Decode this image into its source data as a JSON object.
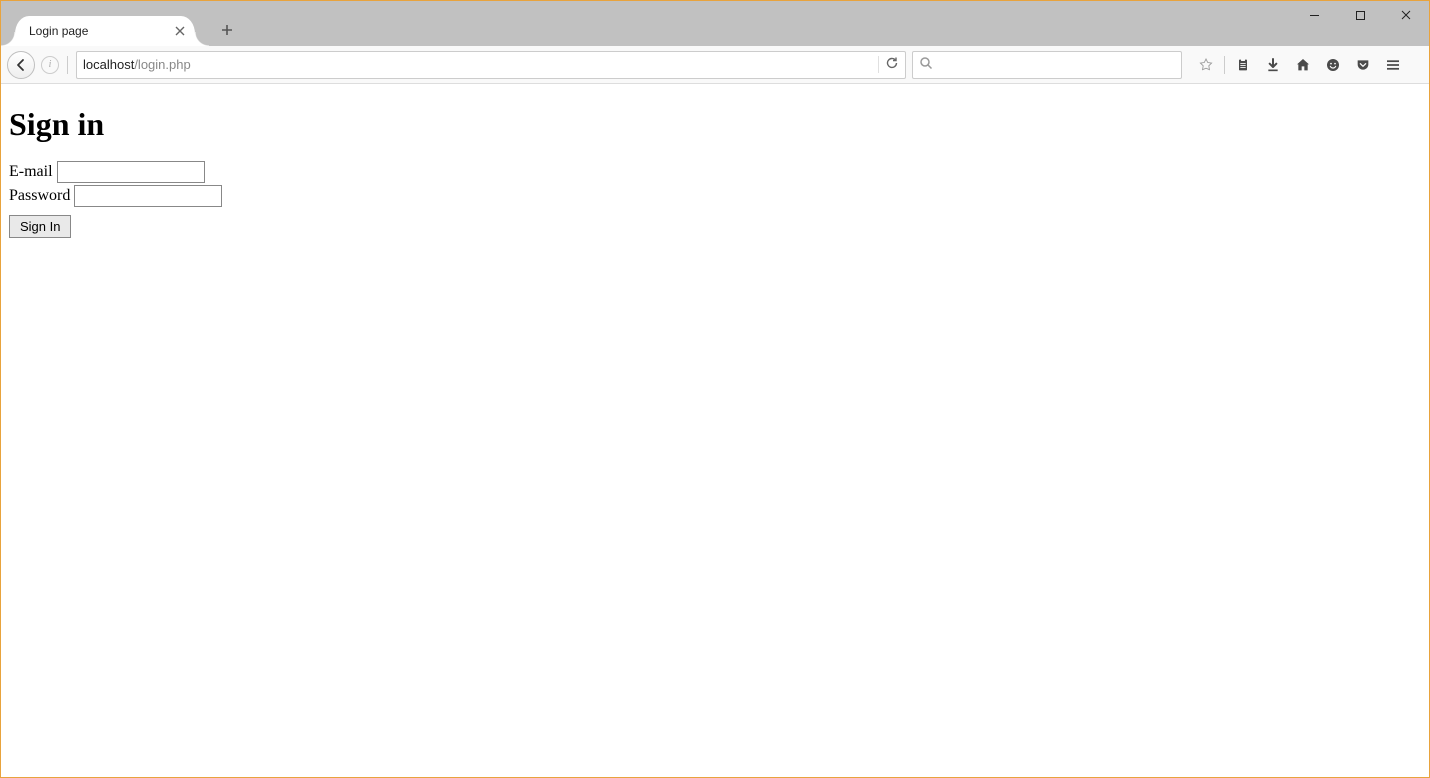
{
  "window": {
    "tab_title": "Login page"
  },
  "address": {
    "host": "localhost",
    "path": "/login.php"
  },
  "page": {
    "heading": "Sign in",
    "email_label": "E-mail",
    "email_value": "",
    "password_label": "Password",
    "password_value": "",
    "submit_label": "Sign In"
  }
}
